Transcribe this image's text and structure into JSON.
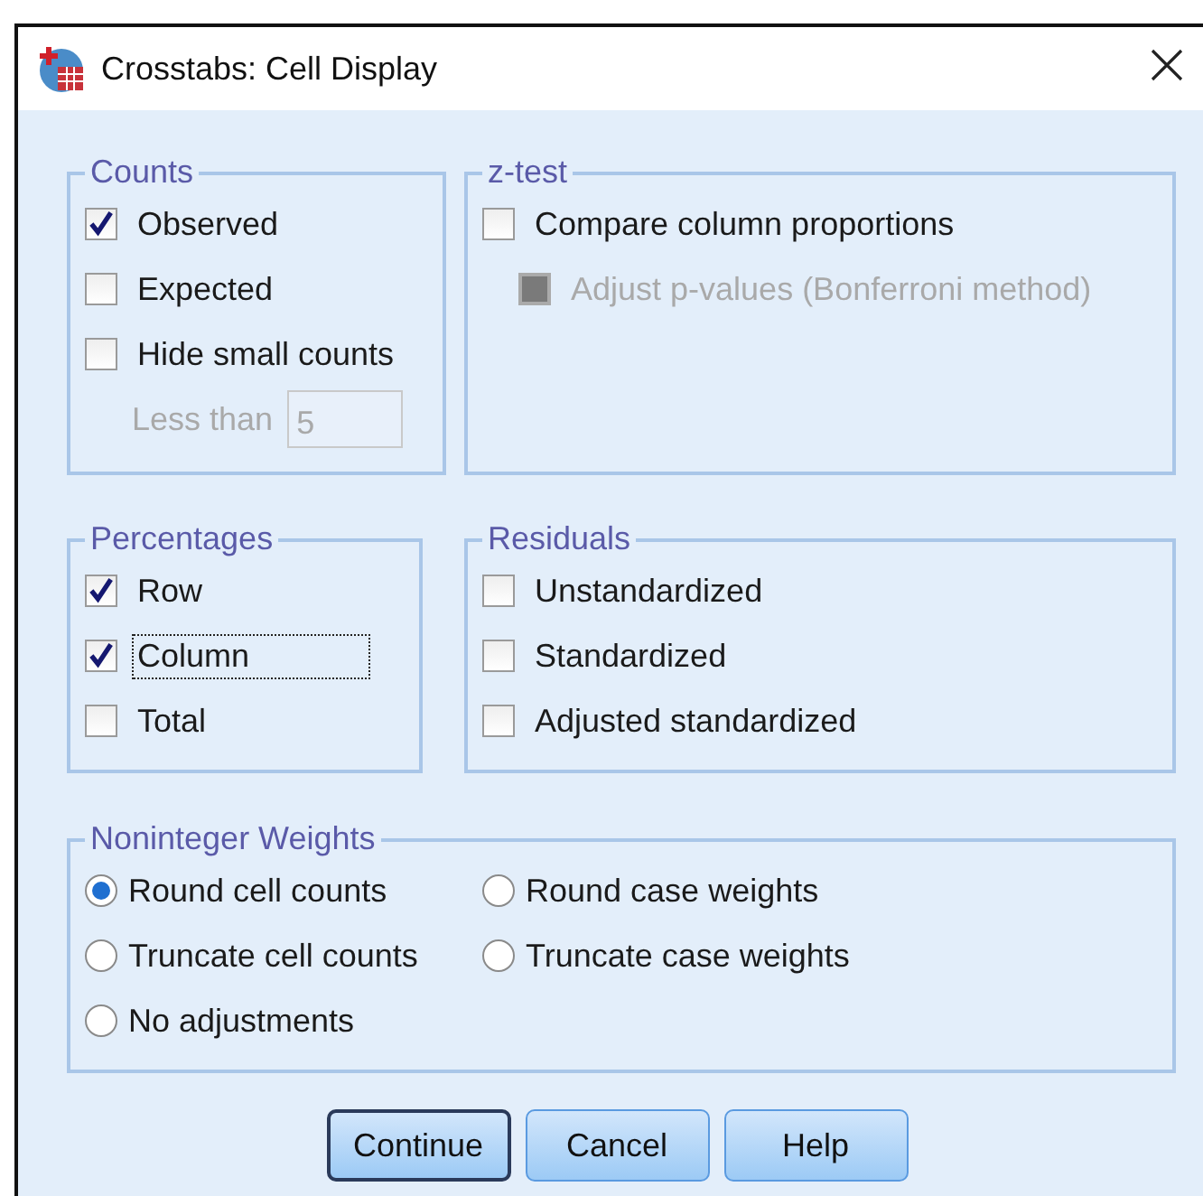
{
  "window": {
    "title": "Crosstabs: Cell Display"
  },
  "rows": [
    {
      "groups": [
        {
          "title": "Counts",
          "items": [
            {
              "kind": "checkbox",
              "label": "Observed",
              "checked": true,
              "focused": false
            },
            {
              "kind": "checkbox",
              "label": "Expected",
              "checked": false,
              "focused": false
            },
            {
              "kind": "checkbox",
              "label": "Hide small counts",
              "checked": false,
              "focused": false
            },
            {
              "kind": "field",
              "label": "Less than",
              "value": "5",
              "disabled": true
            }
          ]
        },
        {
          "title": "z-test",
          "items": [
            {
              "kind": "checkbox",
              "label": "Compare column proportions",
              "checked": false,
              "focused": false,
              "children": [
                {
                  "kind": "checkbox",
                  "label": "Adjust p-values (Bonferroni method)",
                  "checked": false,
                  "focused": false,
                  "disabled": true
                }
              ]
            }
          ]
        }
      ]
    },
    {
      "groups": [
        {
          "title": "Percentages",
          "items": [
            {
              "kind": "checkbox",
              "label": "Row",
              "checked": true,
              "focused": false
            },
            {
              "kind": "checkbox",
              "label": "Column",
              "checked": true,
              "focused": true
            },
            {
              "kind": "checkbox",
              "label": "Total",
              "checked": false,
              "focused": false
            }
          ]
        },
        {
          "title": "Residuals",
          "items": [
            {
              "kind": "checkbox",
              "label": "Unstandardized",
              "checked": false,
              "focused": false
            },
            {
              "kind": "checkbox",
              "label": "Standardized",
              "checked": false,
              "focused": false
            },
            {
              "kind": "checkbox",
              "label": "Adjusted standardized",
              "checked": false,
              "focused": false
            }
          ]
        }
      ]
    }
  ],
  "noninteger_weights": {
    "title": "Noninteger Weights",
    "options": [
      {
        "label": "Round cell counts",
        "selected": true
      },
      {
        "label": "Round case weights",
        "selected": false
      },
      {
        "label": "Truncate cell counts",
        "selected": false
      },
      {
        "label": "Truncate case weights",
        "selected": false
      },
      {
        "label": "No adjustments",
        "selected": false
      }
    ]
  },
  "buttons": [
    {
      "label": "Continue",
      "default": true
    },
    {
      "label": "Cancel",
      "default": false
    },
    {
      "label": "Help",
      "default": false
    }
  ]
}
